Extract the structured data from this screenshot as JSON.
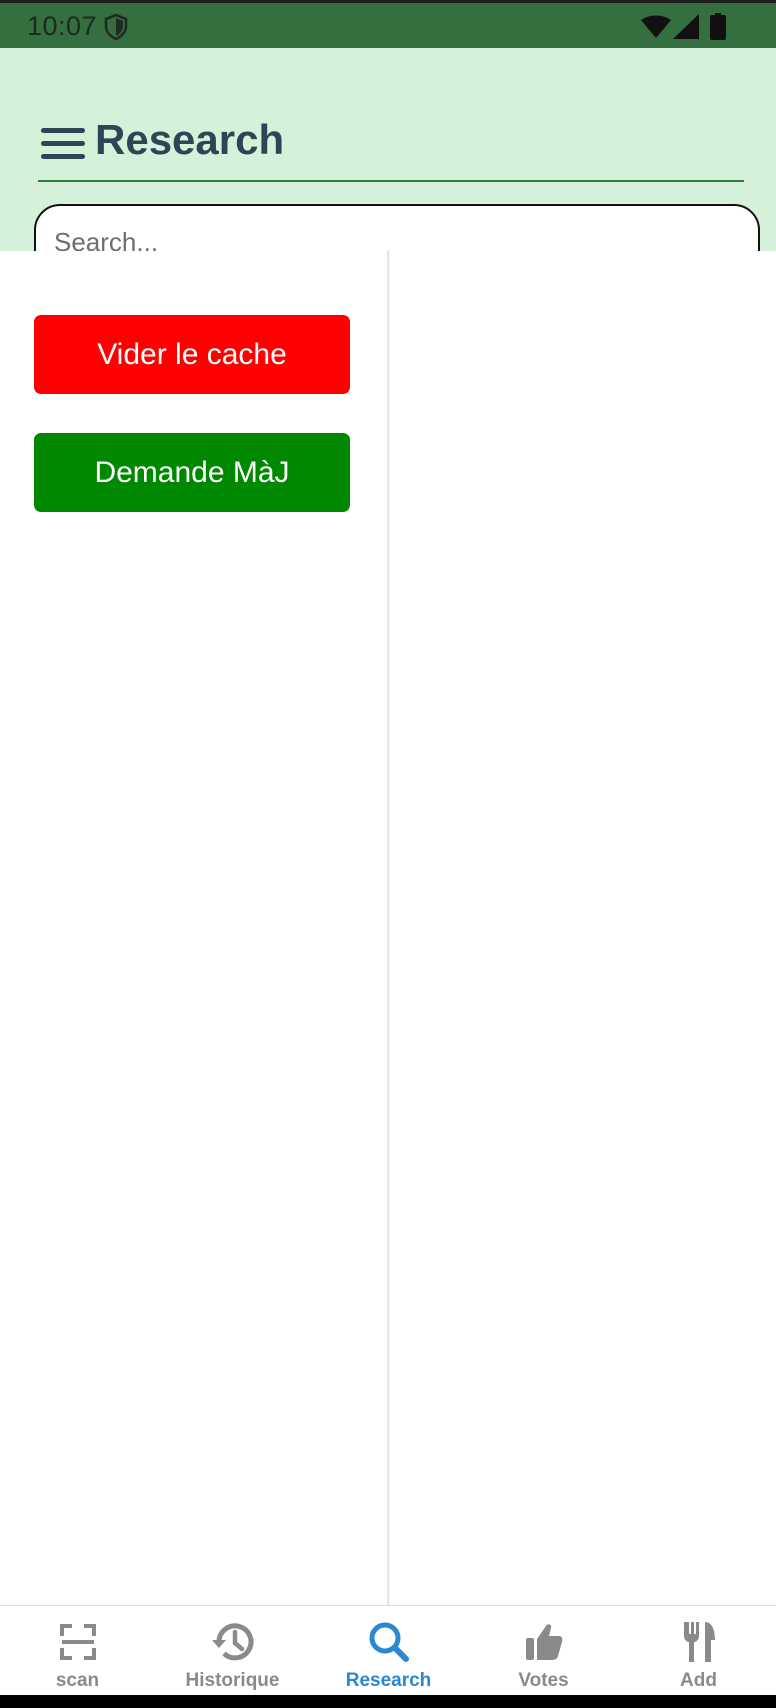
{
  "status_bar": {
    "time": "10:07"
  },
  "header": {
    "title": "Research",
    "search_placeholder": "Search..."
  },
  "actions": {
    "clear_cache_label": "Vider le cache",
    "clear_cache_color": "#ff0000",
    "request_update_label": "Demande MàJ",
    "request_update_color": "#008800"
  },
  "bottom_nav": {
    "items": [
      {
        "label": "scan",
        "icon": "scan-icon",
        "active": false
      },
      {
        "label": "Historique",
        "icon": "history-icon",
        "active": false
      },
      {
        "label": "Research",
        "icon": "search-icon",
        "active": true
      },
      {
        "label": "Votes",
        "icon": "thumbs-up-icon",
        "active": false
      },
      {
        "label": "Add",
        "icon": "fork-knife-icon",
        "active": false
      }
    ],
    "active_color": "#2a87d0",
    "inactive_color": "#8a8a8a"
  },
  "colors": {
    "status_bar": "#356e3f",
    "header_background": "#d5f1d9",
    "title_text": "#2c4655"
  }
}
